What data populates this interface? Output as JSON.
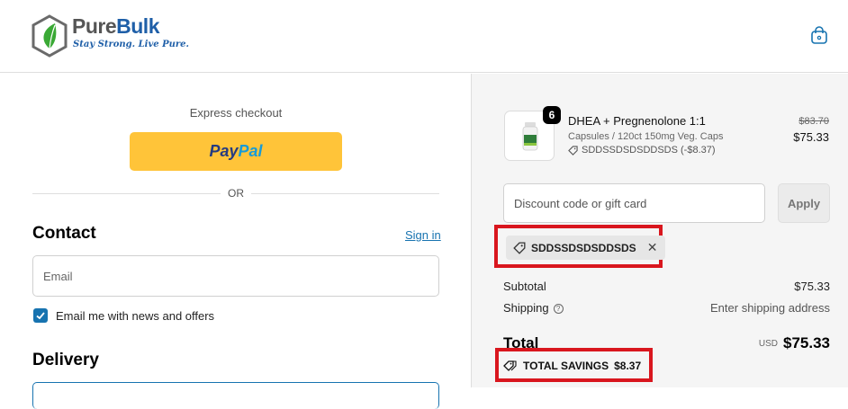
{
  "brand": {
    "name_part1": "Pure",
    "name_part2": "Bulk",
    "tagline": "Stay Strong. Live Pure."
  },
  "header": {
    "cart_icon": "shopping-bag-icon"
  },
  "checkout": {
    "express_label": "Express checkout",
    "paypal_part1": "Pay",
    "paypal_part2": "Pal",
    "or_label": "OR",
    "contact_heading": "Contact",
    "sign_in_label": "Sign in",
    "email_placeholder": "Email",
    "newsletter_label": "Email me with news and offers",
    "newsletter_checked": true,
    "delivery_heading": "Delivery"
  },
  "order": {
    "product": {
      "quantity": "6",
      "name": "DHEA + Pregnenolone 1:1",
      "variant": "Capsules / 120ct 150mg Veg. Caps",
      "discount_line": "SDDSSDSDSDDSDS (-$8.37)",
      "original_price": "$83.70",
      "price": "$75.33"
    },
    "discount_placeholder": "Discount code or gift card",
    "apply_label": "Apply",
    "applied_code": "SDDSSDSDSDDSDS",
    "subtotal_label": "Subtotal",
    "subtotal_value": "$75.33",
    "shipping_label": "Shipping",
    "shipping_value": "Enter shipping address",
    "total_label": "Total",
    "currency": "USD",
    "total_value": "$75.33",
    "savings_label": "TOTAL SAVINGS",
    "savings_value": "$8.37"
  },
  "colors": {
    "accent": "#1773b0",
    "paypal": "#ffc439",
    "highlight": "#d9161e"
  }
}
